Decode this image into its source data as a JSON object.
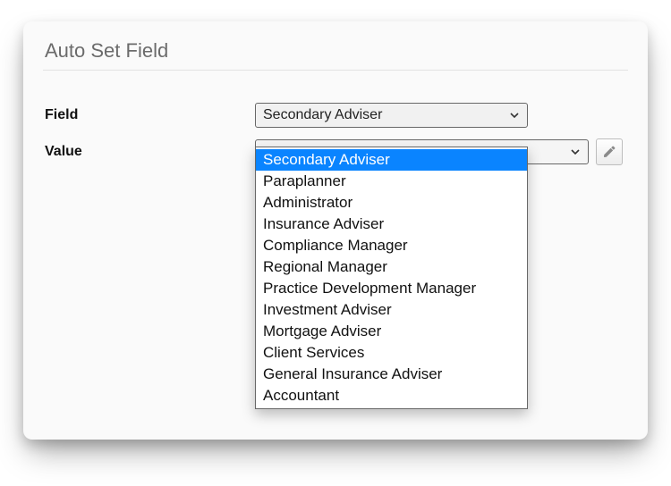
{
  "title": "Auto Set Field",
  "rows": {
    "field": {
      "label": "Field",
      "selected": "Secondary Adviser"
    },
    "value": {
      "label": "Value",
      "selected": ""
    }
  },
  "dropdown": {
    "highlightedIndex": 0,
    "options": [
      "Secondary Adviser",
      "Paraplanner",
      "Administrator",
      "Insurance Adviser",
      "Compliance Manager",
      "Regional Manager",
      "Practice Development Manager",
      "Investment Adviser",
      "Mortgage Adviser",
      "Client Services",
      "General Insurance Adviser",
      "Accountant"
    ]
  }
}
